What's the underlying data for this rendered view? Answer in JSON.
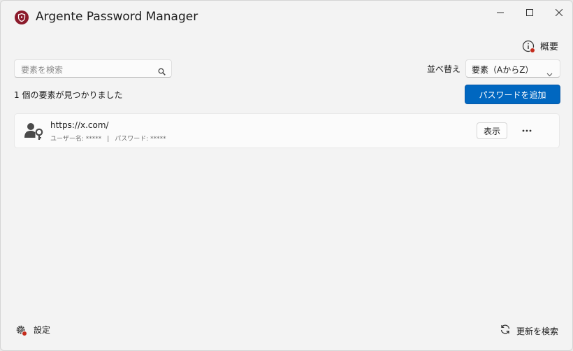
{
  "window": {
    "title": "Argente Password Manager",
    "accent_color": "#0067c0",
    "brand_color": "#8b1a2b",
    "badge_color": "#c42b1c"
  },
  "header": {
    "about_label": "概要"
  },
  "toolbar": {
    "search_placeholder": "要素を検索",
    "sort_label": "並べ替え",
    "sort_value": "要素（AからZ）",
    "results_count": "1 個の要素が見つかりました",
    "add_button_label": "パスワードを追加"
  },
  "entries": [
    {
      "url": "https://x.com/",
      "username_label": "ユーザー名: *****",
      "separator": "|",
      "password_label": "パスワード: *****",
      "show_button_label": "表示",
      "icon": "user-key-icon"
    }
  ],
  "footer": {
    "settings_label": "設定",
    "check_updates_label": "更新を検索"
  }
}
